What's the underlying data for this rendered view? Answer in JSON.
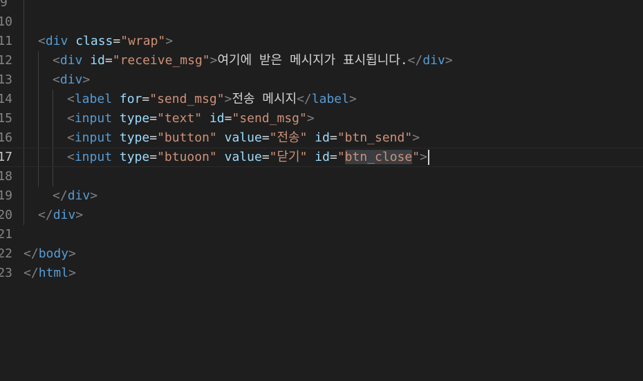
{
  "editor": {
    "lines": [
      {
        "number": "9",
        "parts": []
      },
      {
        "number": "10",
        "parts": []
      },
      {
        "number": "11",
        "parts": [
          {
            "k": "indent",
            "n": 1
          },
          {
            "k": "punc",
            "t": "<"
          },
          {
            "k": "tag",
            "t": "div"
          },
          {
            "k": "txt",
            "t": " "
          },
          {
            "k": "attr",
            "t": "class"
          },
          {
            "k": "eq",
            "t": "="
          },
          {
            "k": "str",
            "t": "\"wrap\""
          },
          {
            "k": "punc",
            "t": ">"
          }
        ]
      },
      {
        "number": "12",
        "parts": [
          {
            "k": "indent",
            "n": 2
          },
          {
            "k": "punc",
            "t": "<"
          },
          {
            "k": "tag",
            "t": "div"
          },
          {
            "k": "txt",
            "t": " "
          },
          {
            "k": "attr",
            "t": "id"
          },
          {
            "k": "eq",
            "t": "="
          },
          {
            "k": "str",
            "t": "\"receive_msg\""
          },
          {
            "k": "punc",
            "t": ">"
          },
          {
            "k": "txt",
            "t": "여기에 받은 메시지가 표시됩니다."
          },
          {
            "k": "punc",
            "t": "</"
          },
          {
            "k": "tag",
            "t": "div"
          },
          {
            "k": "punc",
            "t": ">"
          }
        ]
      },
      {
        "number": "13",
        "parts": [
          {
            "k": "indent",
            "n": 2
          },
          {
            "k": "punc",
            "t": "<"
          },
          {
            "k": "tag",
            "t": "div"
          },
          {
            "k": "punc",
            "t": ">"
          }
        ]
      },
      {
        "number": "14",
        "parts": [
          {
            "k": "indent",
            "n": 3
          },
          {
            "k": "punc",
            "t": "<"
          },
          {
            "k": "tag",
            "t": "label"
          },
          {
            "k": "txt",
            "t": " "
          },
          {
            "k": "attr",
            "t": "for"
          },
          {
            "k": "eq",
            "t": "="
          },
          {
            "k": "str",
            "t": "\"send_msg\""
          },
          {
            "k": "punc",
            "t": ">"
          },
          {
            "k": "txt",
            "t": "전송 메시지"
          },
          {
            "k": "punc",
            "t": "</"
          },
          {
            "k": "tag",
            "t": "label"
          },
          {
            "k": "punc",
            "t": ">"
          }
        ]
      },
      {
        "number": "15",
        "parts": [
          {
            "k": "indent",
            "n": 3
          },
          {
            "k": "punc",
            "t": "<"
          },
          {
            "k": "tag",
            "t": "input"
          },
          {
            "k": "txt",
            "t": " "
          },
          {
            "k": "attr",
            "t": "type"
          },
          {
            "k": "eq",
            "t": "="
          },
          {
            "k": "str",
            "t": "\"text\""
          },
          {
            "k": "txt",
            "t": " "
          },
          {
            "k": "attr",
            "t": "id"
          },
          {
            "k": "eq",
            "t": "="
          },
          {
            "k": "str",
            "t": "\"send_msg\""
          },
          {
            "k": "punc",
            "t": ">"
          }
        ]
      },
      {
        "number": "16",
        "parts": [
          {
            "k": "indent",
            "n": 3
          },
          {
            "k": "punc",
            "t": "<"
          },
          {
            "k": "tag",
            "t": "input"
          },
          {
            "k": "txt",
            "t": " "
          },
          {
            "k": "attr",
            "t": "type"
          },
          {
            "k": "eq",
            "t": "="
          },
          {
            "k": "str",
            "t": "\"button\""
          },
          {
            "k": "txt",
            "t": " "
          },
          {
            "k": "attr",
            "t": "value"
          },
          {
            "k": "eq",
            "t": "="
          },
          {
            "k": "str",
            "t": "\"전송\""
          },
          {
            "k": "txt",
            "t": " "
          },
          {
            "k": "attr",
            "t": "id"
          },
          {
            "k": "eq",
            "t": "="
          },
          {
            "k": "str",
            "t": "\"btn_send\""
          },
          {
            "k": "punc",
            "t": ">"
          }
        ]
      },
      {
        "number": "17",
        "active": true,
        "parts": [
          {
            "k": "indent",
            "n": 3
          },
          {
            "k": "punc",
            "t": "<"
          },
          {
            "k": "tag",
            "t": "input"
          },
          {
            "k": "txt",
            "t": " "
          },
          {
            "k": "attr",
            "t": "type"
          },
          {
            "k": "eq",
            "t": "="
          },
          {
            "k": "str",
            "t": "\"btuoon\""
          },
          {
            "k": "txt",
            "t": " "
          },
          {
            "k": "attr",
            "t": "value"
          },
          {
            "k": "eq",
            "t": "="
          },
          {
            "k": "str",
            "t": "\"닫기\""
          },
          {
            "k": "txt",
            "t": " "
          },
          {
            "k": "attr",
            "t": "id"
          },
          {
            "k": "eq",
            "t": "="
          },
          {
            "k": "str",
            "t": "\""
          },
          {
            "k": "str",
            "t": "btn_close",
            "sel": true
          },
          {
            "k": "str",
            "t": "\""
          },
          {
            "k": "punc",
            "t": ">"
          },
          {
            "k": "cursor"
          }
        ]
      },
      {
        "number": "18",
        "parts": []
      },
      {
        "number": "19",
        "parts": [
          {
            "k": "indent",
            "n": 2
          },
          {
            "k": "punc",
            "t": "</"
          },
          {
            "k": "tag",
            "t": "div"
          },
          {
            "k": "punc",
            "t": ">"
          }
        ]
      },
      {
        "number": "20",
        "parts": [
          {
            "k": "indent",
            "n": 1
          },
          {
            "k": "punc",
            "t": "</"
          },
          {
            "k": "tag",
            "t": "div"
          },
          {
            "k": "punc",
            "t": ">"
          }
        ]
      },
      {
        "number": "21",
        "parts": []
      },
      {
        "number": "22",
        "parts": [
          {
            "k": "punc",
            "t": "</"
          },
          {
            "k": "tag",
            "t": "body"
          },
          {
            "k": "punc",
            "t": ">"
          }
        ]
      },
      {
        "number": "23",
        "parts": [
          {
            "k": "punc",
            "t": "</"
          },
          {
            "k": "tag",
            "t": "html"
          },
          {
            "k": "punc",
            "t": ">"
          }
        ]
      }
    ]
  }
}
